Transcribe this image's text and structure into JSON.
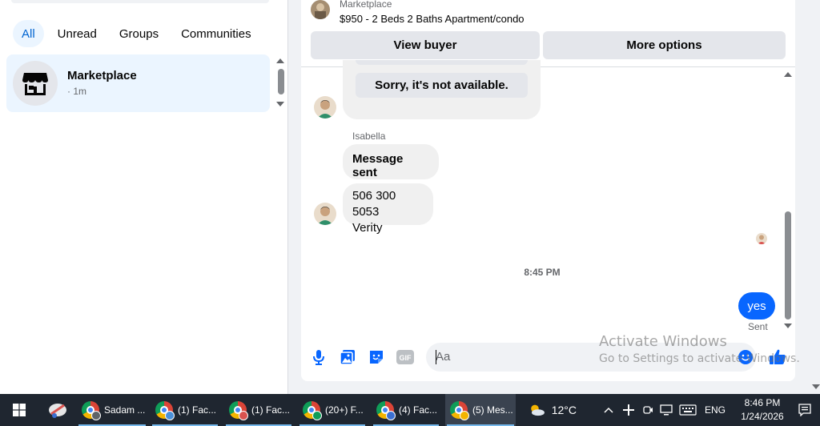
{
  "sidebar": {
    "filters": [
      {
        "label": "All",
        "active": true
      },
      {
        "label": "Unread",
        "active": false
      },
      {
        "label": "Groups",
        "active": false
      },
      {
        "label": "Communities",
        "active": false
      }
    ],
    "chat_item": {
      "name": "Marketplace",
      "time": "· 1m",
      "icon": "storefront-icon"
    }
  },
  "listing": {
    "source": "Marketplace",
    "title": "$950 - 2 Beds 2 Baths Apartment/condo",
    "view_buyer_label": "View buyer",
    "more_options_label": "More options"
  },
  "messages": {
    "quoted_option": "Sorry, it's not available.",
    "sender_name": "Isabella",
    "message_sent": "Message sent",
    "phone_line1": "506 300 5053",
    "phone_line2": "Verity",
    "timestamp": "8:45 PM",
    "my_reply": "yes",
    "status": "Sent"
  },
  "composer": {
    "placeholder": "Aa",
    "icons": [
      "microphone-icon",
      "photo-icon",
      "sticker-icon",
      "gif-icon",
      "emoji-icon",
      "thumbs-up-icon"
    ],
    "gif_text": "GIF"
  },
  "watermark": {
    "title": "Activate Windows",
    "subtitle": "Go to Settings to activate Windows."
  },
  "taskbar": {
    "tasks": [
      {
        "label": "Sadam ..."
      },
      {
        "label": "(1) Fac..."
      },
      {
        "label": "(1) Fac..."
      },
      {
        "label": "(20+) F..."
      },
      {
        "label": "(4) Fac..."
      },
      {
        "label": "(5) Mes..."
      }
    ],
    "weather": "12°C",
    "language": "ENG",
    "time": "8:46 PM",
    "date": "1/24/2026"
  },
  "colors": {
    "accent": "#0866ff",
    "active_filter_bg": "#ebf5ff",
    "bubble_gray": "#f0f0f0",
    "taskbar_bg": "#1f2630"
  }
}
